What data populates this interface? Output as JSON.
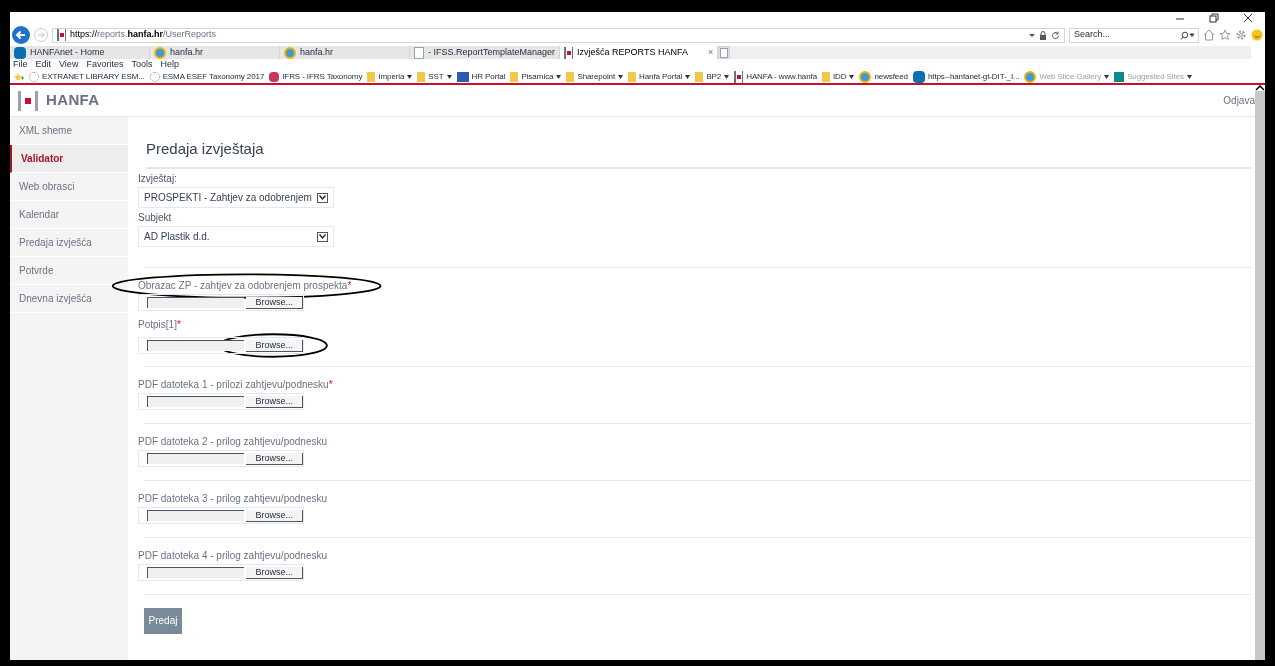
{
  "browser": {
    "address": {
      "scheme": "https://",
      "host_pre": "reports.",
      "host_bold": "hanfa.hr",
      "path": "/UserReports"
    },
    "search_placeholder": "Search...",
    "tabs": [
      {
        "label": "HANFAnet - Home",
        "selected": false
      },
      {
        "label": "hanfa.hr",
        "selected": false
      },
      {
        "label": "hanfa.hr",
        "selected": false
      },
      {
        "label": "- IFSS.ReportTemplateManager",
        "selected": false
      },
      {
        "label": "Izvješća REPORTS HANFA",
        "selected": true
      }
    ],
    "close_tab": "×",
    "menu": [
      "File",
      "Edit",
      "View",
      "Favorites",
      "Tools",
      "Help"
    ],
    "favorites": [
      {
        "label": "EXTRANET LIBRARY ESM...",
        "menu": false,
        "dimmed": false
      },
      {
        "label": "ESMA ESEF Taxonomy 2017",
        "menu": false,
        "dimmed": false
      },
      {
        "label": "IFRS - IFRS Taxonomy",
        "menu": false,
        "dimmed": false
      },
      {
        "label": "Imperia",
        "menu": true,
        "dimmed": false
      },
      {
        "label": "SST",
        "menu": true,
        "dimmed": false
      },
      {
        "label": "HR Portal",
        "menu": false,
        "dimmed": false
      },
      {
        "label": "Pisarnica",
        "menu": true,
        "dimmed": false
      },
      {
        "label": "Sharepoint",
        "menu": true,
        "dimmed": false
      },
      {
        "label": "Hanfa Portal",
        "menu": true,
        "dimmed": false
      },
      {
        "label": "BP2",
        "menu": true,
        "dimmed": false
      },
      {
        "label": "HANFA - www.hanfa",
        "menu": false,
        "dimmed": false
      },
      {
        "label": "IDD",
        "menu": true,
        "dimmed": false
      },
      {
        "label": "newsfeed",
        "menu": false,
        "dimmed": false
      },
      {
        "label": "https--hanfanet-gt-DIT-_I...",
        "menu": false,
        "dimmed": false
      },
      {
        "label": "Web Slice Gallery",
        "menu": true,
        "dimmed": true
      },
      {
        "label": "Suggested Sites",
        "menu": true,
        "dimmed": true
      }
    ]
  },
  "site": {
    "logo": "HANFA",
    "logout": "Odjava"
  },
  "sidebar": [
    {
      "label": "XML sheme",
      "selected": false
    },
    {
      "label": "Validator",
      "selected": true
    },
    {
      "label": "Web obrasci",
      "selected": false
    },
    {
      "label": "Kalendar",
      "selected": false
    },
    {
      "label": "Predaja izvješća",
      "selected": false
    },
    {
      "label": "Potvrde",
      "selected": false
    },
    {
      "label": "Dnevna izvješća",
      "selected": false
    }
  ],
  "page_title": "Predaja izvještaja",
  "selects": [
    {
      "label": "Izvještaj:",
      "value": "PROSPEKTI - Zahtjev za odobrenjem"
    },
    {
      "label": "Subjekt",
      "value": "AD Plastik d.d."
    }
  ],
  "required_mark": "*",
  "files": [
    {
      "label": "Obrazac ZP - zahtjev za odobrenjem prospekta",
      "required": true,
      "button": "Browse...",
      "circled_label": true,
      "circled_button": false
    },
    {
      "label": "Potpis[1]",
      "required": true,
      "button": "Browse...",
      "circled_label": false,
      "circled_button": true
    },
    {
      "label": "PDF datoteka 1 - prilozi zahtjevu/podnesku",
      "required": true,
      "button": "Browse...",
      "circled_label": false,
      "circled_button": false
    },
    {
      "label": "PDF datoteka 2 - prilog zahtjevu/podnesku",
      "required": false,
      "button": "Browse...",
      "circled_label": false,
      "circled_button": false
    },
    {
      "label": "PDF datoteka 3 - prilog zahtjevu/podnesku",
      "required": false,
      "button": "Browse...",
      "circled_label": false,
      "circled_button": false
    },
    {
      "label": "PDF datoteka 4 - prilog zahtjevu/podnesku",
      "required": false,
      "button": "Browse...",
      "circled_label": false,
      "circled_button": false
    }
  ],
  "submit": "Predaj"
}
